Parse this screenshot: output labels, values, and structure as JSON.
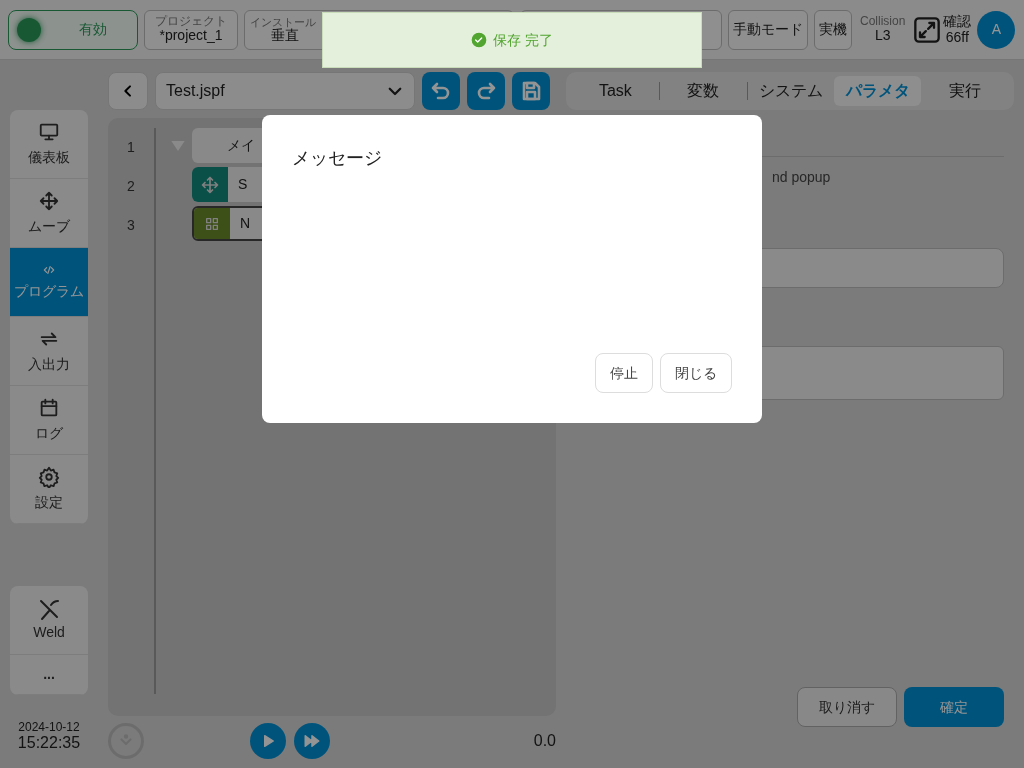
{
  "status_bar": {
    "enable": {
      "label": "有効",
      "on": true
    },
    "project": {
      "label": "プロジェクト",
      "value": "*project_1"
    },
    "install": {
      "label": "インストール",
      "value": "垂直"
    },
    "mode_button": "手動モード",
    "machine_button": "実機",
    "collision": {
      "label": "Collision",
      "value": "L3"
    },
    "confirm": {
      "label": "確認",
      "value": "66ff"
    },
    "avatar": "A"
  },
  "toast": {
    "text": "保存 完了"
  },
  "sidebar": {
    "items": [
      {
        "label": "儀表板",
        "selected": false
      },
      {
        "label": "ムーブ",
        "selected": false
      },
      {
        "label": "プログラム",
        "selected": true
      },
      {
        "label": "入出力",
        "selected": false
      },
      {
        "label": "ログ",
        "selected": false
      },
      {
        "label": "設定",
        "selected": false
      }
    ],
    "extra": [
      {
        "label": "Weld",
        "kind": "tool"
      },
      {
        "label": "...",
        "kind": "more"
      }
    ],
    "date": "2024-10-12",
    "time": "15:22:35"
  },
  "editor": {
    "file": "Test.jspf",
    "lines": [
      {
        "number": "1",
        "text": "メイ",
        "kind": "folder"
      },
      {
        "number": "2",
        "text": "S",
        "kind": "move"
      },
      {
        "number": "3",
        "text": "N",
        "kind": "grid"
      }
    ],
    "speed": "0.0"
  },
  "tabs": [
    {
      "label": "Task",
      "selected": false
    },
    {
      "label": "変数",
      "selected": false
    },
    {
      "label": "システム",
      "selected": false
    },
    {
      "label": "パラメタ",
      "selected": true
    },
    {
      "label": "実行",
      "selected": false
    }
  ],
  "panel": {
    "hint": "nd popup",
    "buttons": [
      {
        "label": "取り消す",
        "kind": "secondary"
      },
      {
        "label": "確定",
        "kind": "primary"
      }
    ]
  },
  "modal": {
    "title": "メッセージ",
    "buttons": [
      "停止",
      "閉じる"
    ]
  }
}
